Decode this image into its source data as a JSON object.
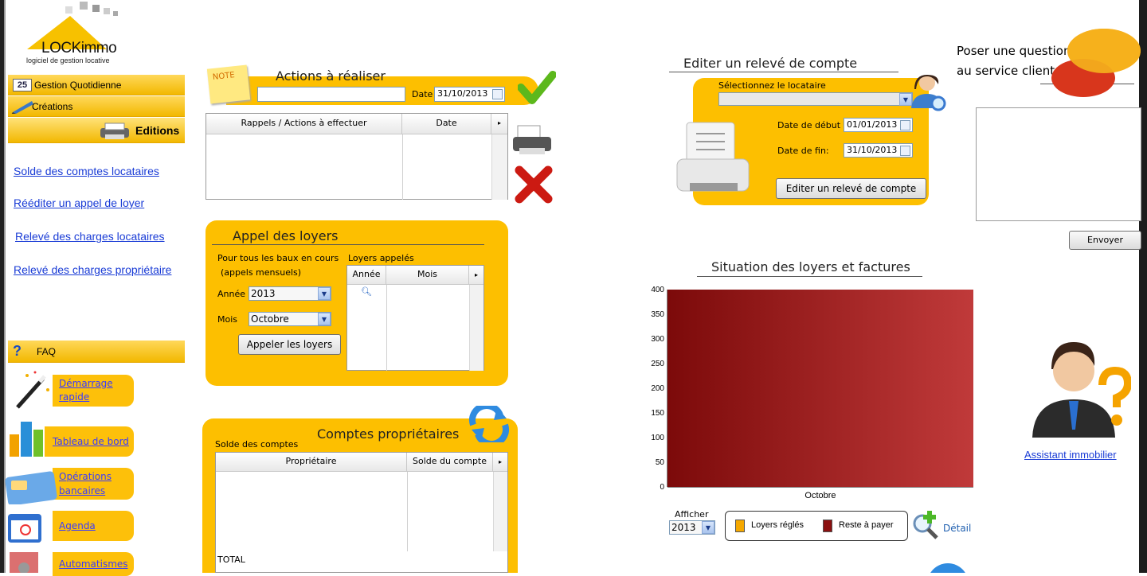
{
  "logo": {
    "name": "LOCKimmo",
    "tagline": "logiciel de gestion locative"
  },
  "sidebar": {
    "menu": [
      {
        "label": "Gestion Quotidienne",
        "icon": "calendar-25-icon",
        "badge": "25"
      },
      {
        "label": "Créations",
        "icon": "pen-icon"
      },
      {
        "label": "Editions",
        "icon": "printer-icon"
      }
    ],
    "links": [
      "Solde des comptes locataires",
      "Rééditer un appel de loyer",
      "Relevé des charges locataires",
      "Relevé des charges propriétaire"
    ],
    "faq_label": "FAQ",
    "faq_items": [
      {
        "label": "Démarrage rapide",
        "icon": "magic-wand-icon"
      },
      {
        "label": "Tableau de bord",
        "icon": "bar-chart-icon"
      },
      {
        "label": "Opérations bancaires",
        "icon": "credit-card-icon"
      },
      {
        "label": "Agenda",
        "icon": "agenda-icon"
      },
      {
        "label": "Automatismes",
        "icon": "gears-icon"
      }
    ]
  },
  "actions": {
    "title": "Actions à réaliser",
    "note_label": "NOTE",
    "date_label": "Date",
    "date_value": "31/10/2013",
    "input_value": "",
    "columns": [
      "Rappels / Actions à effectuer",
      "Date"
    ]
  },
  "loyers": {
    "title": "Appel des loyers",
    "desc_line1": "Pour tous les baux en cours",
    "desc_line2": "(appels mensuels)",
    "annee_label": "Année",
    "annee_value": "2013",
    "mois_label": "Mois",
    "mois_value": "Octobre",
    "button": "Appeler les loyers",
    "list_title": "Loyers appelés",
    "columns": [
      "Année",
      "Mois"
    ]
  },
  "comptes": {
    "title": "Comptes propriétaires",
    "subtitle": "Solde des comptes",
    "columns": [
      "Propriétaire",
      "Solde du compte"
    ],
    "total_label": "TOTAL"
  },
  "releve": {
    "title": "Editer un relevé de compte",
    "select_label": "Sélectionnez le locataire",
    "select_value": "",
    "start_label": "Date de début",
    "start_value": "01/01/2013",
    "end_label": "Date de fin:",
    "end_value": "31/10/2013",
    "button": "Editer un relevé de compte"
  },
  "question": {
    "line1": "Poser une question",
    "line2": "au service client",
    "message": "",
    "button": "Envoyer"
  },
  "assistant": {
    "label": "Assistant immobilier"
  },
  "chart_section": {
    "afficher_label": "Afficher",
    "year_value": "2013",
    "detail_label": "Détail"
  },
  "chart_data": {
    "type": "bar",
    "title": "Situation des loyers et factures",
    "categories": [
      "Octobre"
    ],
    "series": [
      {
        "name": "Loyers réglés",
        "values": [
          0
        ],
        "color": "#f5a800"
      },
      {
        "name": "Reste à payer",
        "values": [
          400
        ],
        "color": "#8b1010"
      }
    ],
    "ylim": [
      0,
      400
    ],
    "yticks": [
      0,
      50,
      100,
      150,
      200,
      250,
      300,
      350,
      400
    ],
    "legend": "bottom"
  }
}
